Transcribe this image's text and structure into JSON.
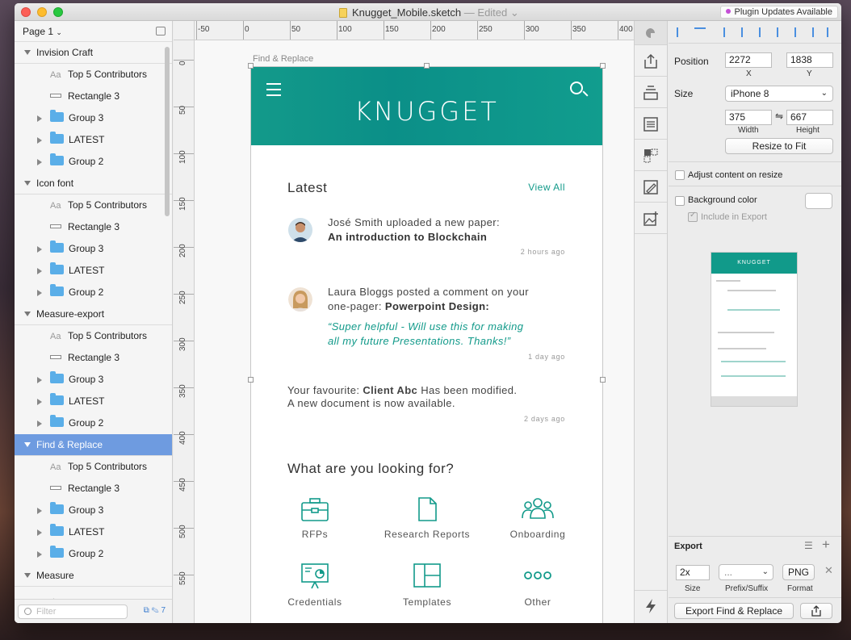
{
  "window": {
    "title": "Knugget_Mobile.sketch",
    "edited": "— Edited",
    "plugin_badge": "Plugin Updates Available"
  },
  "layers": {
    "page": "Page 1",
    "filter_placeholder": "Filter",
    "footer_count": "7",
    "groups": [
      {
        "name": "Invision Craft",
        "children": [
          "Top 5 Contributors",
          "Rectangle 3",
          "Group 3",
          "LATEST",
          "Group 2"
        ]
      },
      {
        "name": "Icon font",
        "children": [
          "Top 5 Contributors",
          "Rectangle 3",
          "Group 3",
          "LATEST",
          "Group 2"
        ]
      },
      {
        "name": "Measure-export",
        "children": [
          "Top 5 Contributors",
          "Rectangle 3",
          "Group 3",
          "LATEST",
          "Group 2"
        ]
      },
      {
        "name": "Find & Replace",
        "children": [
          "Top 5 Contributors",
          "Rectangle 3",
          "Group 3",
          "LATEST",
          "Group 2"
        ]
      },
      {
        "name": "Measure",
        "children": []
      }
    ]
  },
  "rulers": {
    "top": [
      "-50",
      "0",
      "50",
      "100",
      "150",
      "200",
      "250",
      "300",
      "350",
      "400"
    ],
    "left": [
      "0",
      "50",
      "100",
      "150",
      "200",
      "250",
      "300",
      "350",
      "400",
      "450",
      "500",
      "550"
    ]
  },
  "artboard": {
    "label": "Find & Replace",
    "brand": "KNUGGET",
    "latest_title": "Latest",
    "view_all": "View All",
    "feed": [
      {
        "line1": "José Smith uploaded a new paper:",
        "line2": "An introduction to Blockchain",
        "time": "2 hours ago"
      },
      {
        "line1": "Laura Bloggs posted a comment on your",
        "line2a": "one-pager: ",
        "line2b": "Powerpoint Design:",
        "quote1": "“Super helpful - Will use this for making",
        "quote2": "all my future Presentations. Thanks!”",
        "time": "1 day ago"
      },
      {
        "line1a": "Your favourite: ",
        "line1b": "Client Abc",
        "line1c": " Has been modified.",
        "line2": "A new document is now available.",
        "time": "2 days ago"
      }
    ],
    "looking_title": "What are you looking for?",
    "categories": [
      "RFPs",
      "Research Reports",
      "Onboarding",
      "Credentials",
      "Templates",
      "Other"
    ]
  },
  "inspector": {
    "position_label": "Position",
    "x_value": "2272",
    "y_value": "1838",
    "x_label": "X",
    "y_label": "Y",
    "size_label": "Size",
    "size_preset": "iPhone 8",
    "width_value": "375",
    "height_value": "667",
    "width_label": "Width",
    "height_label": "Height",
    "resize_button": "Resize to Fit",
    "adjust_label": "Adjust content on resize",
    "bg_label": "Background color",
    "include_label": "Include in Export",
    "preview_brand": "KNUGGET",
    "export_title": "Export",
    "export_scale": "2x",
    "export_suffix": "...",
    "export_format": "PNG",
    "size_col": "Size",
    "suffix_col": "Prefix/Suffix",
    "format_col": "Format",
    "export_button": "Export Find & Replace"
  },
  "colors": {
    "accent": "#129a8a",
    "selection": "#6e9be0"
  }
}
